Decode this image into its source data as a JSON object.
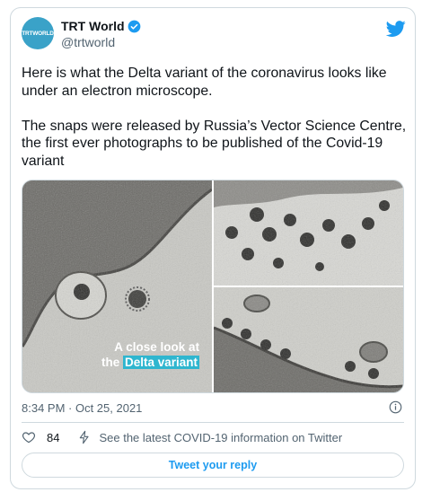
{
  "tweet": {
    "author_name": "TRT World",
    "handle": "@trtworld",
    "avatar_text": "TRTWORLD",
    "paragraphs": [
      "Here is what the Delta variant of the coronavirus looks like under an electron microscope.",
      "The snaps were released by Russia’s Vector Science Centre, the first ever photographs to be published of the Covid-19 variant"
    ],
    "media_caption_line1": "A close look at",
    "media_caption_line2_prefix": "the",
    "media_caption_line2_highlight": "Delta variant",
    "timestamp": "8:34 PM · Oct 25, 2021",
    "like_count": "84",
    "covid_info_link": "See the latest COVID-19 information on Twitter",
    "reply_button": "Tweet your reply"
  },
  "icons": {
    "verified": "verified-badge-icon",
    "bird": "twitter-bird-icon",
    "info": "info-icon",
    "heart": "heart-icon",
    "bolt": "lightning-icon"
  },
  "colors": {
    "brand_blue": "#1d9bf0",
    "avatar_bg": "#3aa2c8",
    "caption_highlight": "#2fb6cf",
    "secondary_text": "#536471",
    "border": "#cfd9de"
  }
}
